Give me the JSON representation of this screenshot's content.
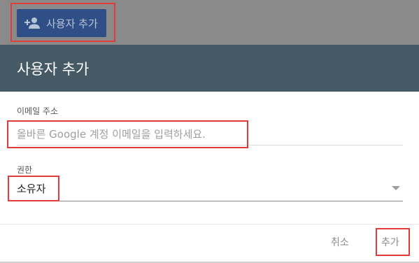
{
  "toolbar": {
    "add_user_label": "사용자 추가",
    "add_user_icon": "person-add-icon"
  },
  "dialog": {
    "title": "사용자 추가",
    "email": {
      "label": "이메일 주소",
      "placeholder": "올바른 Google 계정 이메일을 입력하세요.",
      "value": ""
    },
    "role": {
      "label": "권한",
      "value": "소유자"
    },
    "cancel_label": "취소",
    "add_label": "추가"
  },
  "colors": {
    "header": "#455a64",
    "button": "#2f4f86",
    "highlight": "#e03c3c"
  }
}
